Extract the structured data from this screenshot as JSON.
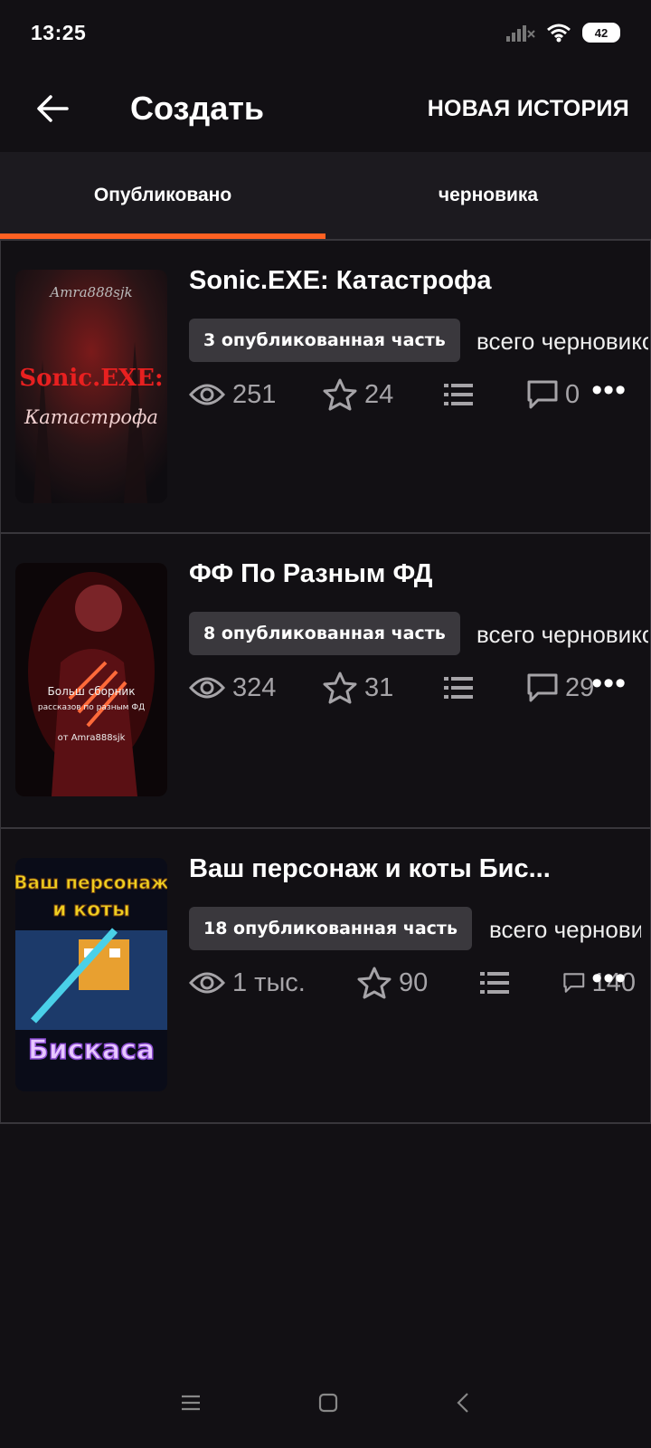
{
  "status": {
    "time": "13:25",
    "battery": "42"
  },
  "appbar": {
    "title": "Создать",
    "new_story": "НОВАЯ ИСТОРИЯ",
    "back_icon": "arrow-left-icon"
  },
  "tabs": [
    {
      "label": "Опубликовано",
      "active": true
    },
    {
      "label": "черновика",
      "active": false
    }
  ],
  "stories": [
    {
      "title": "Sonic.EXE: Катастрофа",
      "parts": "3 опубликованная часть",
      "drafts": "всего черновиков",
      "views": "251",
      "votes": "24",
      "comments": "0",
      "cover": {
        "line1": "Amra888sjk",
        "line2": "Sonic.EXE:",
        "line3": "Катастрофа"
      }
    },
    {
      "title": "ФФ По Разным ФД",
      "parts": "8 опубликованная часть",
      "drafts": "всего черновиков",
      "views": "324",
      "votes": "31",
      "comments": "29",
      "cover": {
        "line1": "Больш сборник",
        "line2": "рассказов по разным ФД",
        "line3": "от Amra888sjk"
      }
    },
    {
      "title": "Ваш персонаж и коты Бис...",
      "parts": "18 опубликованная часть",
      "drafts": "всего черновиков",
      "views": "1 тыс.",
      "votes": "90",
      "comments": "140",
      "cover": {
        "line1": "Ваш персонаж",
        "line2": "и коты",
        "line3": "Бискаса"
      }
    }
  ],
  "colors": {
    "accent": "#ff6122",
    "background": "#121014",
    "tab_bar": "#1c1a1f",
    "badge": "#3a383d"
  }
}
